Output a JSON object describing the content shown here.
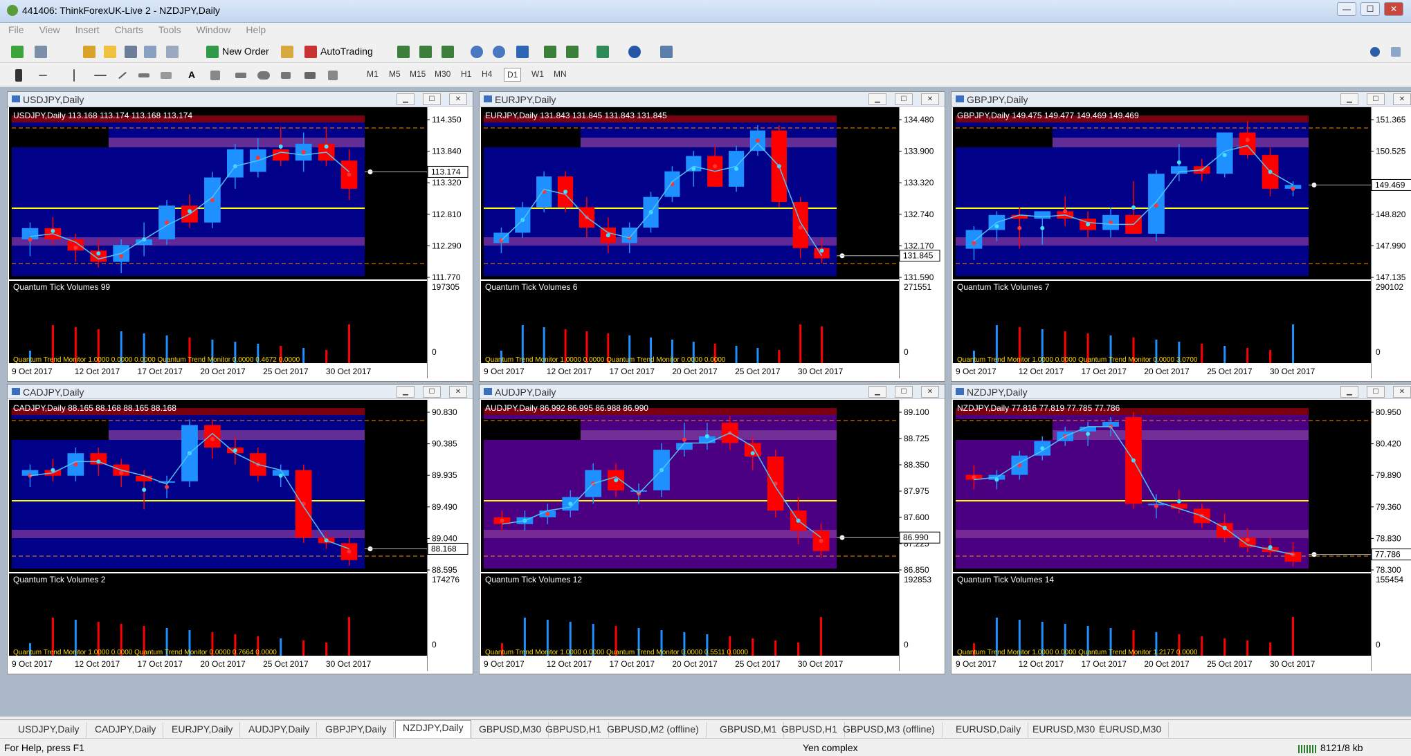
{
  "window": {
    "title": "441406: ThinkForexUK-Live 2 - NZDJPY,Daily",
    "min": "—",
    "max": "☐",
    "close": "✕"
  },
  "menu": [
    "File",
    "View",
    "Insert",
    "Charts",
    "Tools",
    "Window",
    "Help"
  ],
  "toolbar": {
    "new_order": "New Order",
    "autotrading": "AutoTrading"
  },
  "timeframes": [
    "M1",
    "M5",
    "M15",
    "M30",
    "H1",
    "H4",
    "D1",
    "W1",
    "MN"
  ],
  "active_timeframe": "D1",
  "charts": [
    {
      "caption": "USDJPY,Daily",
      "header": "USDJPY,Daily  113.168 113.174 113.168 113.174",
      "prices": [
        "114.350",
        "113.840",
        "113.320",
        "112.810",
        "112.290",
        "111.770"
      ],
      "current": "113.174",
      "volumes_label": "Quantum Tick Volumes 99",
      "vol_max": "197305",
      "vol_zero": "0",
      "trend_text": "Quantum Trend Monitor 1.0000 0.0000 0.0000  Quantum Trend Monitor 0.0000 0.4672 0.0000",
      "dates": [
        "9 Oct 2017",
        "12 Oct 2017",
        "17 Oct 2017",
        "20 Oct 2017",
        "25 Oct 2017",
        "30 Oct 2017"
      ],
      "candles": [
        [
          112.3,
          112.6,
          112.0,
          112.5
        ],
        [
          112.5,
          112.7,
          112.2,
          112.3
        ],
        [
          112.3,
          112.4,
          111.9,
          112.1
        ],
        [
          112.1,
          112.3,
          111.8,
          111.9
        ],
        [
          111.9,
          112.3,
          111.7,
          112.2
        ],
        [
          112.2,
          112.6,
          112.0,
          112.3
        ],
        [
          112.3,
          113.0,
          112.2,
          112.9
        ],
        [
          112.9,
          113.1,
          112.5,
          112.6
        ],
        [
          112.6,
          113.5,
          112.5,
          113.4
        ],
        [
          113.4,
          114.0,
          113.2,
          113.9
        ],
        [
          113.5,
          114.1,
          113.4,
          113.9
        ],
        [
          113.9,
          114.3,
          113.6,
          113.7
        ],
        [
          113.7,
          114.2,
          113.5,
          114.0
        ],
        [
          114.0,
          114.3,
          113.6,
          113.7
        ],
        [
          113.7,
          113.9,
          113.0,
          113.2
        ]
      ],
      "range": [
        111.6,
        114.6
      ],
      "zone": "blue"
    },
    {
      "caption": "EURJPY,Daily",
      "header": "EURJPY,Daily  131.843 131.845 131.843 131.845",
      "prices": [
        "134.480",
        "133.900",
        "133.320",
        "132.740",
        "132.170",
        "131.590"
      ],
      "current": "131.845",
      "volumes_label": "Quantum Tick Volumes 6",
      "vol_max": "271551",
      "vol_zero": "0",
      "trend_text": "Quantum Trend Monitor 1.0000 0.0000  Quantum Trend Monitor 0.0000 0.0000",
      "dates": [
        "9 Oct 2017",
        "12 Oct 2017",
        "17 Oct 2017",
        "20 Oct 2017",
        "25 Oct 2017",
        "30 Oct 2017"
      ],
      "candles": [
        [
          132.1,
          132.4,
          131.9,
          132.3
        ],
        [
          132.3,
          132.9,
          132.2,
          132.8
        ],
        [
          132.8,
          133.5,
          132.7,
          133.4
        ],
        [
          133.4,
          133.5,
          132.7,
          132.8
        ],
        [
          132.8,
          133.0,
          132.2,
          132.4
        ],
        [
          132.4,
          132.6,
          131.9,
          132.1
        ],
        [
          132.1,
          132.5,
          131.9,
          132.4
        ],
        [
          132.4,
          133.1,
          132.3,
          133.0
        ],
        [
          133.0,
          133.6,
          132.9,
          133.5
        ],
        [
          133.5,
          133.9,
          133.2,
          133.8
        ],
        [
          133.8,
          134.0,
          133.2,
          133.2
        ],
        [
          133.2,
          134.0,
          133.1,
          133.9
        ],
        [
          133.9,
          134.4,
          133.8,
          134.3
        ],
        [
          134.3,
          134.4,
          132.8,
          132.9
        ],
        [
          132.9,
          133.0,
          131.8,
          132.0
        ],
        [
          132.0,
          132.2,
          131.7,
          131.8
        ]
      ],
      "range": [
        131.4,
        134.7
      ],
      "zone": "blue"
    },
    {
      "caption": "GBPJPY,Daily",
      "header": "GBPJPY,Daily  149.475 149.477 149.469 149.469",
      "prices": [
        "151.365",
        "150.525",
        "149.670",
        "148.820",
        "147.990",
        "147.135"
      ],
      "current": "149.469",
      "volumes_label": "Quantum Tick Volumes 7",
      "vol_max": "290102",
      "vol_zero": "0",
      "trend_text": "Quantum Trend Monitor 1.0000 0.0000  Quantum Trend Monitor 0.0000 3.0700",
      "dates": [
        "9 Oct 2017",
        "12 Oct 2017",
        "17 Oct 2017",
        "20 Oct 2017",
        "25 Oct 2017",
        "30 Oct 2017"
      ],
      "candles": [
        [
          147.8,
          148.4,
          147.5,
          148.3
        ],
        [
          148.3,
          148.8,
          148.0,
          148.7
        ],
        [
          148.7,
          148.9,
          147.8,
          148.6
        ],
        [
          148.6,
          148.8,
          147.9,
          148.8
        ],
        [
          148.8,
          149.2,
          148.4,
          148.6
        ],
        [
          148.6,
          148.8,
          148.1,
          148.3
        ],
        [
          148.3,
          148.9,
          148.1,
          148.7
        ],
        [
          148.7,
          149.6,
          148.2,
          148.2
        ],
        [
          148.2,
          149.9,
          148.0,
          149.8
        ],
        [
          149.8,
          150.6,
          149.6,
          150.0
        ],
        [
          150.0,
          150.2,
          149.6,
          149.8
        ],
        [
          149.8,
          150.9,
          149.7,
          150.9
        ],
        [
          150.9,
          151.2,
          150.2,
          150.3
        ],
        [
          150.3,
          150.5,
          149.2,
          149.4
        ],
        [
          149.4,
          149.6,
          149.2,
          149.5
        ]
      ],
      "range": [
        147.0,
        151.5
      ],
      "zone": "blue"
    },
    {
      "caption": "CADJPY,Daily",
      "header": "CADJPY,Daily  88.165 88.168 88.165 88.168",
      "prices": [
        "90.830",
        "90.385",
        "89.935",
        "89.490",
        "89.040",
        "88.595"
      ],
      "current": "88.168",
      "volumes_label": "Quantum Tick Volumes 2",
      "vol_max": "174276",
      "vol_zero": "0",
      "trend_text": "Quantum Trend Monitor 1.0000 0.0000  Quantum Trend Monitor 0.0000 0.7664 0.0000",
      "dates": [
        "9 Oct 2017",
        "12 Oct 2017",
        "17 Oct 2017",
        "20 Oct 2017",
        "25 Oct 2017",
        "30 Oct 2017"
      ],
      "candles": [
        [
          89.7,
          89.9,
          89.5,
          89.8
        ],
        [
          89.8,
          90.0,
          89.6,
          89.7
        ],
        [
          89.7,
          90.2,
          89.6,
          90.1
        ],
        [
          90.1,
          90.2,
          89.7,
          89.9
        ],
        [
          89.9,
          90.0,
          89.5,
          89.7
        ],
        [
          89.7,
          89.8,
          89.1,
          89.6
        ],
        [
          89.6,
          89.7,
          89.3,
          89.6
        ],
        [
          89.6,
          90.7,
          89.5,
          90.6
        ],
        [
          90.6,
          90.7,
          90.0,
          90.2
        ],
        [
          90.2,
          90.4,
          89.9,
          90.1
        ],
        [
          90.1,
          90.2,
          89.6,
          89.7
        ],
        [
          89.7,
          89.9,
          89.5,
          89.8
        ],
        [
          89.8,
          89.9,
          88.5,
          88.6
        ],
        [
          88.6,
          88.7,
          88.4,
          88.5
        ],
        [
          88.5,
          88.6,
          88.1,
          88.2
        ]
      ],
      "range": [
        88.0,
        91.0
      ],
      "zone": "blue"
    },
    {
      "caption": "AUDJPY,Daily",
      "header": "AUDJPY,Daily  86.992 86.995 86.988 86.990",
      "prices": [
        "89.100",
        "88.725",
        "88.350",
        "87.975",
        "87.600",
        "87.225",
        "86.850"
      ],
      "current": "86.990",
      "volumes_label": "Quantum Tick Volumes 12",
      "vol_max": "192853",
      "vol_zero": "0",
      "trend_text": "Quantum Trend Monitor 1.0000 0.0000  Quantum Trend Monitor 0.0000 0.5511 0.0000",
      "dates": [
        "9 Oct 2017",
        "12 Oct 2017",
        "17 Oct 2017",
        "20 Oct 2017",
        "25 Oct 2017",
        "30 Oct 2017"
      ],
      "candles": [
        [
          87.5,
          87.6,
          87.3,
          87.4
        ],
        [
          87.4,
          87.6,
          87.3,
          87.5
        ],
        [
          87.5,
          87.7,
          87.4,
          87.6
        ],
        [
          87.6,
          87.9,
          87.5,
          87.8
        ],
        [
          87.8,
          88.3,
          87.7,
          88.2
        ],
        [
          88.2,
          88.3,
          87.8,
          87.9
        ],
        [
          87.9,
          88.0,
          87.7,
          87.9
        ],
        [
          87.9,
          88.6,
          87.8,
          88.5
        ],
        [
          88.5,
          88.9,
          88.4,
          88.6
        ],
        [
          88.6,
          88.9,
          88.5,
          88.7
        ],
        [
          88.9,
          89.0,
          88.5,
          88.6
        ],
        [
          88.6,
          88.7,
          88.2,
          88.4
        ],
        [
          88.4,
          88.5,
          87.5,
          87.6
        ],
        [
          87.6,
          87.8,
          87.1,
          87.3
        ],
        [
          87.3,
          87.4,
          86.9,
          87.0
        ]
      ],
      "range": [
        86.7,
        89.2
      ],
      "zone": "purple"
    },
    {
      "caption": "NZDJPY,Daily",
      "header": "NZDJPY,Daily  77.816 77.819 77.785 77.786",
      "prices": [
        "80.950",
        "80.420",
        "79.890",
        "79.360",
        "78.830",
        "78.300"
      ],
      "current": "77.786",
      "volumes_label": "Quantum Tick Volumes 14",
      "vol_max": "155454",
      "vol_zero": "0",
      "trend_text": "Quantum Trend Monitor 1.0000 0.0000  Quantum Trend Monitor 1.2177 0.0000",
      "dates": [
        "9 Oct 2017",
        "12 Oct 2017",
        "17 Oct 2017",
        "20 Oct 2017",
        "25 Oct 2017",
        "30 Oct 2017"
      ],
      "candles": [
        [
          79.6,
          79.8,
          79.3,
          79.5
        ],
        [
          79.5,
          79.7,
          79.3,
          79.6
        ],
        [
          79.6,
          80.1,
          79.5,
          80.0
        ],
        [
          80.0,
          80.4,
          79.9,
          80.3
        ],
        [
          80.3,
          80.6,
          80.2,
          80.5
        ],
        [
          80.5,
          80.7,
          80.2,
          80.6
        ],
        [
          80.6,
          80.8,
          80.4,
          80.7
        ],
        [
          80.8,
          80.9,
          78.9,
          79.0
        ],
        [
          79.0,
          79.2,
          78.7,
          79.0
        ],
        [
          79.0,
          79.3,
          78.8,
          78.9
        ],
        [
          78.9,
          79.0,
          78.5,
          78.6
        ],
        [
          78.6,
          78.8,
          78.2,
          78.3
        ],
        [
          78.3,
          78.5,
          78.0,
          78.1
        ],
        [
          78.1,
          78.3,
          77.9,
          78.0
        ],
        [
          78.0,
          78.2,
          77.7,
          77.8
        ]
      ],
      "range": [
        77.6,
        81.1
      ],
      "zone": "purple"
    }
  ],
  "tabs": [
    "USDJPY,Daily",
    "CADJPY,Daily",
    "EURJPY,Daily",
    "AUDJPY,Daily",
    "GBPJPY,Daily",
    "NZDJPY,Daily",
    "GBPUSD,M30",
    "GBPUSD,H1",
    "GBPUSD,M2 (offline)",
    "GBPUSD,M1",
    "GBPUSD,H1",
    "GBPUSD,M3 (offline)",
    "EURUSD,Daily",
    "EURUSD,M30",
    "EURUSD,M30"
  ],
  "active_tab": "NZDJPY,Daily",
  "status": {
    "help": "For Help, press F1",
    "profile": "Yen complex",
    "traffic": "8121/8 kb"
  },
  "colors": {
    "bull": "#1e90ff",
    "bear": "#ff0000",
    "chart_bg": "#000000",
    "zone_blue": "#000088",
    "zone_purple": "#4b0082",
    "ma": "#4fc3f7",
    "level": "#ffff00"
  }
}
